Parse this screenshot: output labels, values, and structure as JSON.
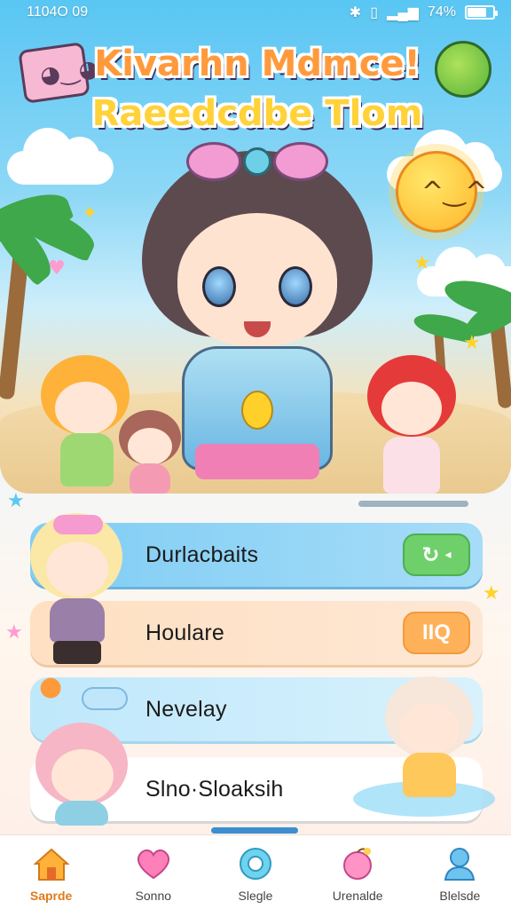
{
  "status_bar": {
    "time": "1104O 09",
    "bluetooth_icon": "bluetooth-icon",
    "signal_icon": "signal-icon",
    "battery_text": "74%",
    "battery_level": 0.74
  },
  "hero": {
    "title_line1": "Kivarhn Mdmce!",
    "title_line2": "Raeedcdbe Tlom",
    "colors": {
      "sky": "#59c6f3",
      "sand": "#f0d6a8",
      "title_orange": "#ff9a3c",
      "title_yellow": "#ffd23a"
    }
  },
  "menu": {
    "items": [
      {
        "label": "Durlacbaits",
        "action": "toggle",
        "action_icon": "refresh-icon"
      },
      {
        "label": "Houlare",
        "action": "counter",
        "action_text": "IIQ"
      },
      {
        "label": "Nevelay"
      },
      {
        "label": "Slno·Sloaksih"
      }
    ]
  },
  "bottom_nav": {
    "items": [
      {
        "label": "Saprde",
        "icon": "home-icon",
        "active": true
      },
      {
        "label": "Sonno",
        "icon": "heart-icon",
        "active": false
      },
      {
        "label": "Slegle",
        "icon": "flower-icon",
        "active": false
      },
      {
        "label": "Urenalde",
        "icon": "apple-icon",
        "active": false
      },
      {
        "label": "Blelsde",
        "icon": "person-icon",
        "active": false
      }
    ]
  }
}
